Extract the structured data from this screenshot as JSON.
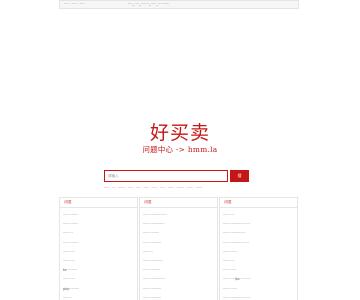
{
  "topbar": {
    "left": "···· · ···· · ····",
    "links": "····_····_·······_·····_··········"
  },
  "logo": "好买卖",
  "slogan": "问题中心 -> hmm.la",
  "search": {
    "placeholder": "请输入",
    "button": "搜"
  },
  "hot_words": [
    "·····",
    "···",
    "·······",
    "·····",
    "····",
    "·····",
    "·····",
    "·····",
    "······",
    "·······",
    "······",
    "······"
  ],
  "panels": [
    {
      "tab": "问答",
      "items": [
        "··············",
        "··············",
        "·········",
        "··············",
        "···········",
        "···········",
        "ta··········",
        "···········",
        "php·········",
        "········"
      ]
    },
    {
      "tab": "问答",
      "items": [
        "······················",
        "····················",
        "···············",
        "·················",
        "·········",
        "···················",
        "················",
        "·····················",
        "·················",
        "·················"
      ]
    },
    {
      "tab": "问答",
      "items": [
        "··········",
        "·························",
        "·····················",
        "························",
        "·············",
        "··········",
        "············",
        "···········/ta··········",
        "·············",
        "·························"
      ]
    }
  ]
}
